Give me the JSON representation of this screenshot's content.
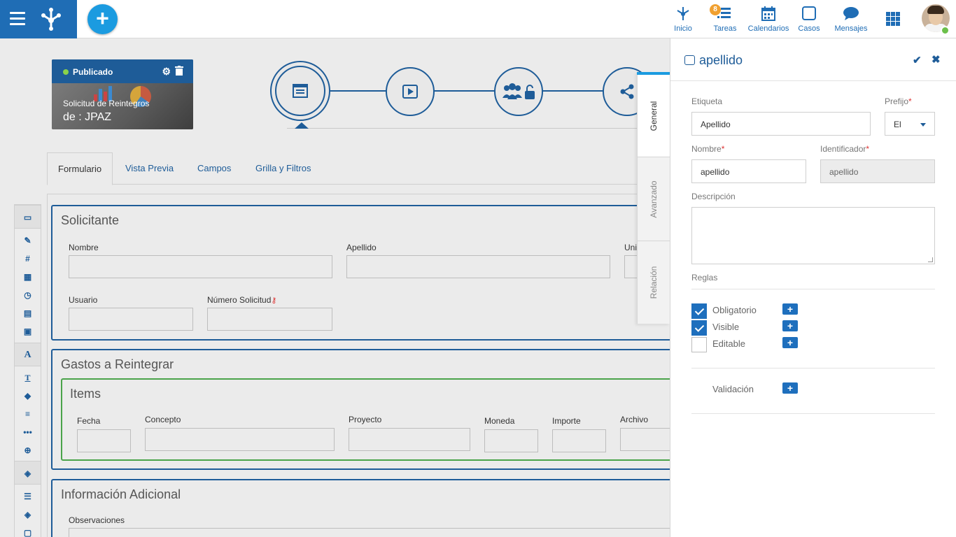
{
  "topnav": {
    "items": [
      {
        "label": "Inicio",
        "icon": "inicio-icon"
      },
      {
        "label": "Tareas",
        "icon": "tasks-icon",
        "badge": "8"
      },
      {
        "label": "Calendarios",
        "icon": "calendar-icon"
      },
      {
        "label": "Casos",
        "icon": "cases-icon"
      },
      {
        "label": "Mensajes",
        "icon": "messages-icon"
      }
    ]
  },
  "card": {
    "status": "Publicado",
    "title_line1": "Solicitud de Reintegros",
    "title_line2": "de : JPAZ"
  },
  "tabs": [
    "Formulario",
    "Vista Previa",
    "Campos",
    "Grilla y Filtros"
  ],
  "form": {
    "sections": [
      {
        "title": "Solicitante",
        "fields": [
          "Nombre",
          "Apellido",
          "Uni",
          "Usuario",
          "Número Solicitud"
        ]
      },
      {
        "title": "Gastos a Reintegrar",
        "inner_title": "Items",
        "fields": [
          "Fecha",
          "Concepto",
          "Proyecto",
          "Moneda",
          "Importe",
          "Archivo"
        ]
      },
      {
        "title": "Información Adicional",
        "fields": [
          "Observaciones"
        ]
      }
    ]
  },
  "side_tabs": [
    "General",
    "Avanzado",
    "Relación"
  ],
  "panel": {
    "title": "apellido",
    "etiqueta_label": "Etiqueta",
    "etiqueta_value": "Apellido",
    "prefijo_label": "Prefijo",
    "prefijo_value": "El",
    "nombre_label": "Nombre",
    "nombre_value": "apellido",
    "identificador_label": "Identificador",
    "identificador_value": "apellido",
    "descripcion_label": "Descripción",
    "reglas_label": "Reglas",
    "rules": [
      {
        "label": "Obligatorio",
        "checked": true
      },
      {
        "label": "Visible",
        "checked": true
      },
      {
        "label": "Editable",
        "checked": false
      }
    ],
    "validacion_label": "Validación",
    "required_mark": "*"
  },
  "colors": {
    "brand": "#1f6db5",
    "accent": "#1b9be0",
    "section_border": "#1e5c98",
    "inner_border": "#4aa34a"
  }
}
